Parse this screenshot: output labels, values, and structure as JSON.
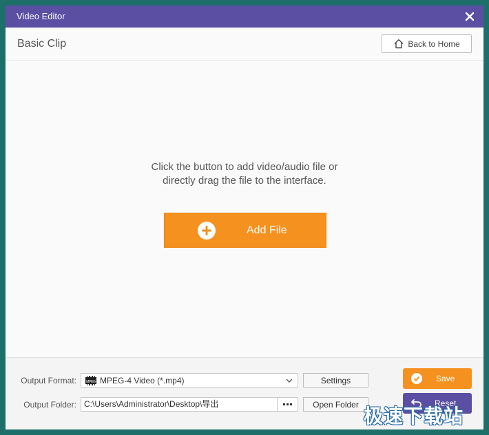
{
  "window": {
    "title": "Video Editor"
  },
  "header": {
    "title": "Basic Clip",
    "back_home_label": "Back to Home"
  },
  "main": {
    "hint_line1": "Click the button to add video/audio file or",
    "hint_line2": "directly drag the file to the interface.",
    "add_file_label": "Add File"
  },
  "footer": {
    "output_format_label": "Output Format:",
    "output_format_value": "MPEG-4 Video (*.mp4)",
    "format_icon_text": "MPEG",
    "settings_label": "Settings",
    "output_folder_label": "Output Folder:",
    "output_folder_value": "C:\\Users\\Administrator\\Desktop\\导出",
    "open_folder_label": "Open Folder",
    "save_label": "Save",
    "reset_label": "Reset"
  },
  "watermark": {
    "text": "极速下载站"
  },
  "colors": {
    "title_bar": "#5b4fa3",
    "accent_orange": "#f5911e",
    "desktop": "#1e6f6a"
  }
}
